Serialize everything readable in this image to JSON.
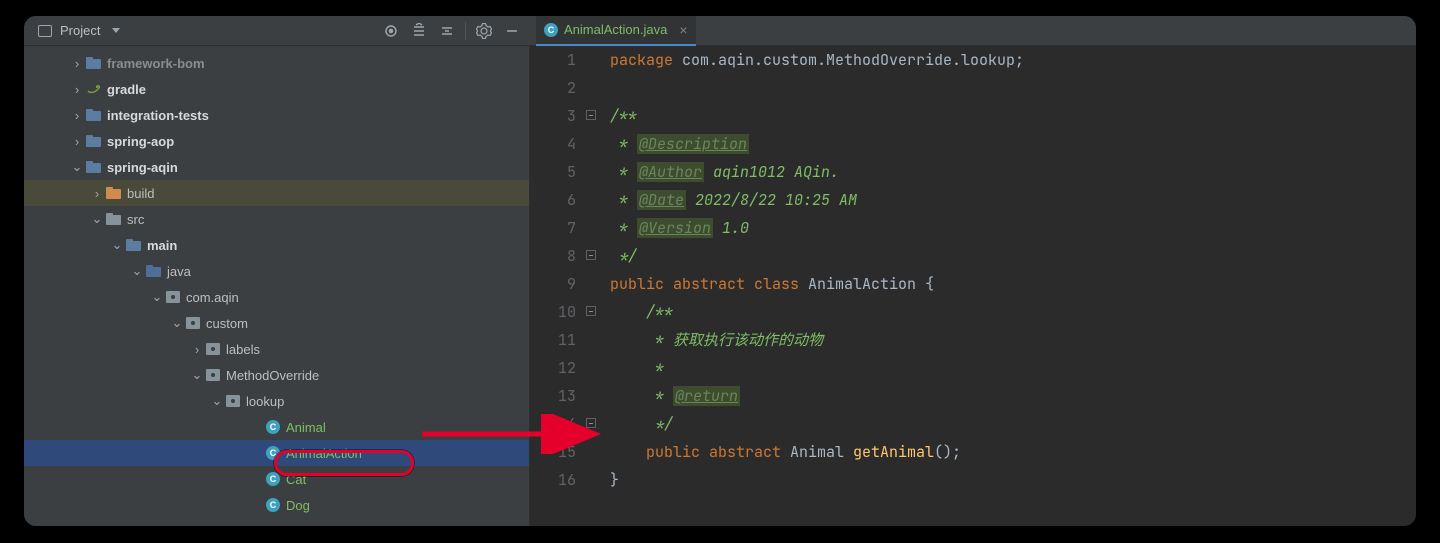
{
  "toolbar": {
    "project_label": "Project"
  },
  "editor_tab": {
    "filename": "AnimalAction.java"
  },
  "tree": {
    "row0": "framework-bom",
    "row1": "gradle",
    "row2": "integration-tests",
    "row3": "spring-aop",
    "row4": "spring-aqin",
    "row5": "build",
    "row6": "src",
    "row7": "main",
    "row8": "java",
    "row9": "com.aqin",
    "row10": "custom",
    "row11": "labels",
    "row12": "MethodOverride",
    "row13": "lookup",
    "row14": "Animal",
    "row15": "AnimalAction",
    "row16": "Cat",
    "row17": "Dog"
  },
  "code": {
    "l1_kw": "package",
    "l1_pkg": " com.aqin.custom.MethodOverride.lookup;",
    "l3": "/**",
    "l4_pre": " * ",
    "l4_tag": "@Description",
    "l5_pre": " * ",
    "l5_tag": "@Author",
    "l5_txt": " aqin1012 AQin.",
    "l6_pre": " * ",
    "l6_tag": "@Date",
    "l6_txt": " 2022/8/22 10:25 AM",
    "l7_pre": " * ",
    "l7_tag": "@Version",
    "l7_txt": " 1.0",
    "l8": " */",
    "l9_kw": "public abstract class ",
    "l9_cls": "AnimalAction",
    "l9_brace": " {",
    "l10": "    /**",
    "l11": "     * 获取执行该动作的动物",
    "l12": "     *",
    "l13_pre": "     * ",
    "l13_tag": "@return",
    "l14": "     */",
    "l15_kw": "    public abstract ",
    "l15_type": "Animal ",
    "l15_mth": "getAnimal",
    "l15_paren": "();",
    "l16": "}"
  }
}
